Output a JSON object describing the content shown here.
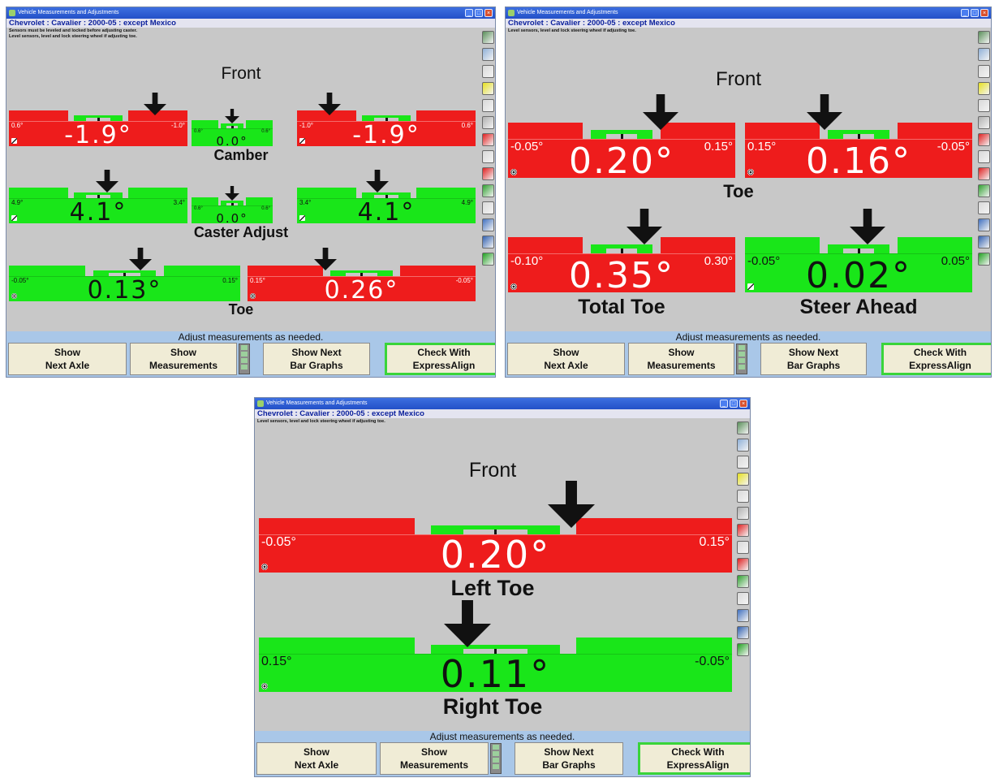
{
  "window_title": "Vehicle Measurements and Adjustments",
  "vehicle": "Chevrolet : Cavalier : 2000-05 : except Mexico",
  "status_text": "Adjust measurements as needed.",
  "buttons": {
    "next_axle": "Show\nNext Axle",
    "measurements": "Show\nMeasurements",
    "next_bar_graphs": "Show Next\nBar Graphs",
    "express_align": "Check With\nExpressAlign"
  },
  "colors": {
    "out_of_spec": "#ee1c1c",
    "in_spec": "#19e619",
    "vehicle_text": "#0a1f9c"
  },
  "screens": [
    {
      "instructions": [
        "Sensors must be leveled and locked before adjusting caster.",
        "Level sensors, level and lock steering wheel if adjusting toe."
      ],
      "axle_label": "Front",
      "groups": [
        {
          "label": "Camber",
          "gauges": [
            {
              "side": "left",
              "status": "out",
              "value": "-1.9°",
              "min": "0.6°",
              "max": "-1.0°",
              "pointer": 0.82,
              "icon": "wrench-icon"
            },
            {
              "side": "cross",
              "status": "in",
              "value": "0.0°",
              "min": "0.6°",
              "max": "0.6°",
              "pointer": 0.5,
              "icon": ""
            },
            {
              "side": "right",
              "status": "out",
              "value": "-1.9°",
              "min": "-1.0°",
              "max": "0.6°",
              "pointer": 0.18,
              "icon": "wrench-icon"
            }
          ]
        },
        {
          "label": "Caster Adjust",
          "gauges": [
            {
              "side": "left",
              "status": "in",
              "value": "4.1°",
              "min": "4.9°",
              "max": "3.4°",
              "pointer": 0.55,
              "icon": "wrench-icon"
            },
            {
              "side": "cross",
              "status": "in",
              "value": "0.0°",
              "min": "0.6°",
              "max": "0.6°",
              "pointer": 0.5,
              "icon": ""
            },
            {
              "side": "right",
              "status": "in",
              "value": "4.1°",
              "min": "3.4°",
              "max": "4.9°",
              "pointer": 0.45,
              "icon": "wrench-icon"
            }
          ]
        },
        {
          "label": "Toe",
          "gauges": [
            {
              "side": "left",
              "status": "in",
              "value": "0.13°",
              "min": "-0.05°",
              "max": "0.15°",
              "pointer": 0.57,
              "icon": "target-icon"
            },
            {
              "side": "right",
              "status": "out",
              "value": "0.26°",
              "min": "0.15°",
              "max": "-0.05°",
              "pointer": 0.34,
              "icon": "target-icon"
            }
          ]
        }
      ]
    },
    {
      "instructions": [
        "Level sensors, level and lock steering wheel if adjusting toe."
      ],
      "axle_label": "Front",
      "groups": [
        {
          "label": "Toe",
          "gauges": [
            {
              "side": "left",
              "status": "out",
              "value": "0.20°",
              "min": "-0.05°",
              "max": "0.15°",
              "pointer": 0.67,
              "icon": "target-icon"
            },
            {
              "side": "right",
              "status": "out",
              "value": "0.16°",
              "min": "0.15°",
              "max": "-0.05°",
              "pointer": 0.35,
              "icon": "target-icon"
            }
          ]
        },
        {
          "label": "Total Toe",
          "gauges": [
            {
              "side": "single",
              "status": "out",
              "value": "0.35°",
              "min": "-0.10°",
              "max": "0.30°",
              "pointer": 0.6,
              "icon": "target-icon"
            }
          ]
        },
        {
          "label": "Steer Ahead",
          "gauges": [
            {
              "side": "single",
              "status": "in",
              "value": "0.02°",
              "min": "-0.05°",
              "max": "0.05°",
              "pointer": 0.54,
              "icon": "wrench-icon"
            }
          ]
        }
      ]
    },
    {
      "instructions": [
        "Level sensors, level and lock steering wheel if adjusting toe."
      ],
      "axle_label": "Front",
      "groups": [
        {
          "label": "Left Toe",
          "gauges": [
            {
              "side": "single",
              "status": "out",
              "value": "0.20°",
              "min": "-0.05°",
              "max": "0.15°",
              "pointer": 0.66,
              "icon": "target-icon"
            }
          ]
        },
        {
          "label": "Right Toe",
          "gauges": [
            {
              "side": "single",
              "status": "in",
              "value": "0.11°",
              "min": "0.15°",
              "max": "-0.05°",
              "pointer": 0.44,
              "icon": "target-icon"
            }
          ]
        }
      ]
    }
  ]
}
